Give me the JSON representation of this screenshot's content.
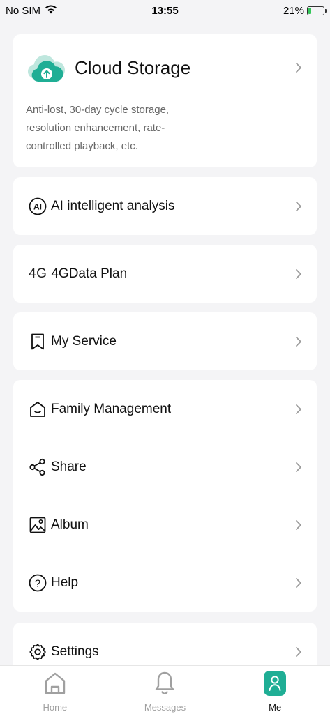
{
  "status_bar": {
    "carrier": "No SIM",
    "time": "13:55",
    "battery_percent": "21%",
    "battery_level": 0.21
  },
  "cloud_storage": {
    "title": "Cloud Storage",
    "description": "Anti-lost, 30-day cycle storage, resolution enhancement, rate-controlled playback, etc.",
    "icon": "cloud-upload-icon",
    "accent_color": "#1fae95"
  },
  "menu": {
    "ai_analysis": {
      "label": "AI intelligent analysis",
      "icon": "ai-icon",
      "icon_text": "AI"
    },
    "data_plan": {
      "label": "4GData Plan",
      "icon_text": "4G"
    },
    "my_service": {
      "label": "My Service",
      "icon": "bookmark-icon"
    },
    "family_management": {
      "label": "Family Management",
      "icon": "home-smile-icon"
    },
    "share": {
      "label": "Share",
      "icon": "share-icon"
    },
    "album": {
      "label": "Album",
      "icon": "image-icon"
    },
    "help": {
      "label": "Help",
      "icon": "help-icon",
      "icon_text": "?"
    },
    "settings": {
      "label": "Settings",
      "icon": "gear-icon"
    }
  },
  "tabbar": {
    "home": "Home",
    "messages": "Messages",
    "me": "Me",
    "active": "me"
  }
}
